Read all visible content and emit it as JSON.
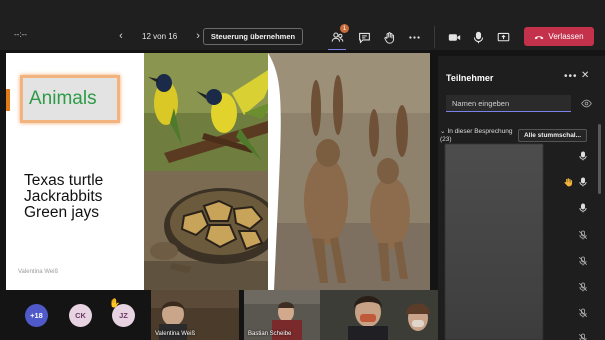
{
  "toolbar": {
    "timer": "--:--",
    "slide_position": "12 von 16",
    "take_control_label": "Steuerung übernehmen",
    "participants_badge": "1",
    "leave_label": "Verlassen",
    "icons": [
      "participants-icon",
      "chat-icon",
      "raise-hand-icon",
      "more-icon",
      "camera-icon",
      "microphone-icon",
      "share-screen-icon",
      "hang-up-icon"
    ]
  },
  "slide": {
    "title": "Animals",
    "items": [
      "Texas turtle",
      "Jackrabbits",
      "Green jays"
    ],
    "author": "Valentina Weiß"
  },
  "panel": {
    "title": "Teilnehmer",
    "search_placeholder": "Namen eingeben",
    "section_label": "In dieser Besprechung (23)",
    "mute_all_label": "Alle stummschal..."
  },
  "strip": {
    "overflow_count": "+18",
    "avatar_ck": "CK",
    "avatar_jz": "JZ",
    "tile1_name": "Valentina Weiß",
    "tile2_name": "Bastian Scheibe"
  },
  "colors": {
    "accent": "#7b83eb",
    "leave": "#c4314b",
    "raised_hand": "#f2b53b",
    "title_green": "#2e9b46"
  }
}
